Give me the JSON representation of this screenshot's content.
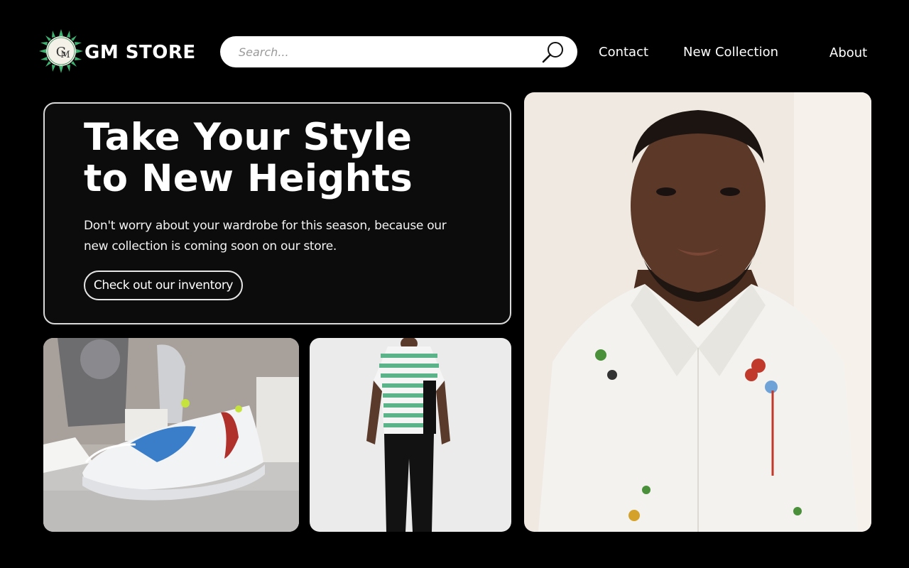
{
  "header": {
    "brand": "GM STORE",
    "logo_icon": "gm-monogram-badge",
    "search": {
      "placeholder": "Search...",
      "value": "",
      "icon": "magnifier-icon"
    },
    "nav": [
      {
        "label": "Contact"
      },
      {
        "label": "New Collection"
      },
      {
        "label": "About"
      }
    ]
  },
  "hero": {
    "title_line1": "Take Your Style",
    "title_line2": "to New Heights",
    "subtitle_line1": "Don't worry about your wardrobe for this season, because our",
    "subtitle_line2": "new collection is coming soon on our store.",
    "cta_label": "Check out our inventory"
  },
  "images": [
    {
      "subject": "white chunky sneaker with blue and red accents on display"
    },
    {
      "subject": "model wearing green striped football jersey and black trousers"
    },
    {
      "subject": "smiling man in white shirt with paint splatter detail"
    }
  ],
  "colors": {
    "background": "#000000",
    "card": "#0c0c0c",
    "border": "#d9d9d9",
    "accent": "#2e8b57"
  }
}
